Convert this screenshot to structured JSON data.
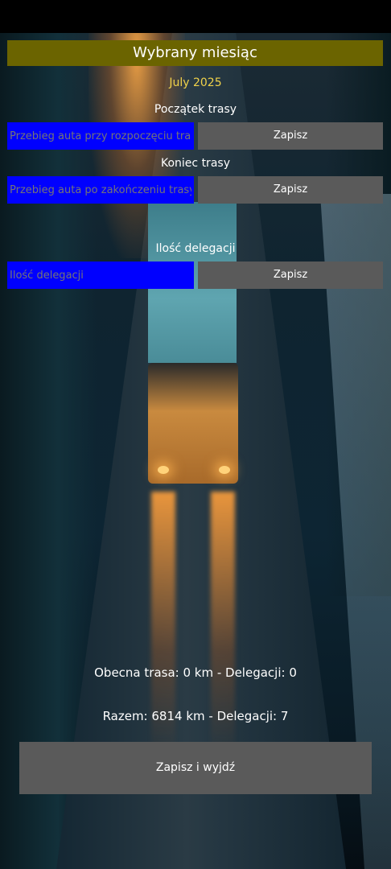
{
  "header": {
    "title": "Wybrany miesiąc"
  },
  "month": "July 2025",
  "route_start": {
    "label": "Początek trasy",
    "placeholder": "Przebieg auta przy rozpoczęciu trasy",
    "save_label": "Zapisz"
  },
  "route_end": {
    "label": "Koniec trasy",
    "placeholder": "Przebieg auta po zakończeniu trasy",
    "save_label": "Zapisz"
  },
  "delegations": {
    "label": "Ilość delegacji",
    "placeholder": "Ilość delegacji",
    "save_label": "Zapisz"
  },
  "summary": {
    "current": "Obecna trasa: 0 km  -  Delegacji: 0",
    "total": "Razem: 6814 km  -  Delegacji: 7"
  },
  "footer": {
    "save_exit_label": "Zapisz i wyjdź"
  },
  "colors": {
    "header_bg": "#6b6400",
    "month_text": "#f0d24a",
    "input_bg": "#0000ff",
    "button_bg": "#5a5a5a"
  }
}
